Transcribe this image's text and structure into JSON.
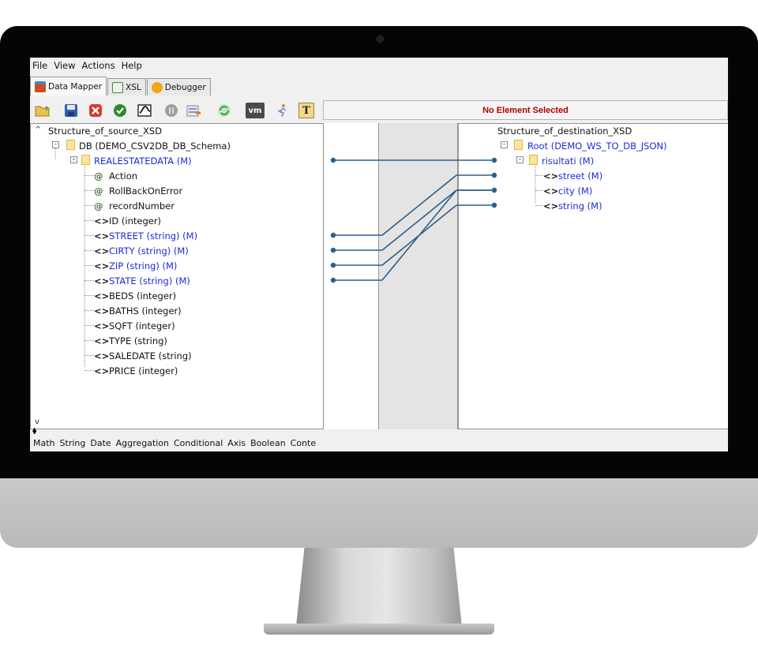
{
  "menu": [
    "File",
    "View",
    "Actions",
    "Help"
  ],
  "tabs": [
    {
      "label": "Data Mapper",
      "icon": "gift-icon",
      "active": true
    },
    {
      "label": "XSL",
      "icon": "xsl-file-icon",
      "active": false
    },
    {
      "label": "Debugger",
      "icon": "debugger-gear-icon",
      "active": false
    }
  ],
  "toolbar": {
    "buttons": [
      {
        "icon": "open-folder-icon"
      },
      {
        "icon": "save-disk-icon"
      },
      {
        "icon": "delete-x-icon"
      },
      {
        "icon": "validate-check-icon"
      },
      {
        "icon": "map-function-icon"
      },
      {
        "icon": "stop-circle-icon"
      },
      {
        "icon": "export-icon"
      },
      {
        "icon": "refresh-icon"
      },
      {
        "icon": "vm-icon",
        "label": "vm"
      },
      {
        "icon": "run-figure-icon"
      },
      {
        "icon": "text-icon",
        "label": "T"
      }
    ],
    "status_text": "No Element Selected",
    "status_color": "#b00000"
  },
  "source": {
    "title": "Structure_of_source_XSD",
    "db": "DB (DEMO_CSV2DB_DB_Schema)",
    "record": "REALESTATEDATA  (M)",
    "fields": [
      {
        "prefix": "@",
        "label": "Action",
        "mapped": false
      },
      {
        "prefix": "@",
        "label": "RollBackOnError",
        "mapped": false
      },
      {
        "prefix": "@",
        "label": "recordNumber",
        "mapped": false
      },
      {
        "prefix": "<>",
        "label": "ID  (integer)",
        "mapped": false
      },
      {
        "prefix": "<>",
        "label": "STREET  (string)  (M)",
        "mapped": true
      },
      {
        "prefix": "<>",
        "label": "CIRTY  (string)  (M)",
        "mapped": true
      },
      {
        "prefix": "<>",
        "label": "ZIP  (string)  (M)",
        "mapped": true
      },
      {
        "prefix": "<>",
        "label": "STATE  (string)  (M)",
        "mapped": true
      },
      {
        "prefix": "<>",
        "label": "BEDS  (integer)",
        "mapped": false
      },
      {
        "prefix": "<>",
        "label": "BATHS  (integer)",
        "mapped": false
      },
      {
        "prefix": "<>",
        "label": "SQFT  (integer)",
        "mapped": false
      },
      {
        "prefix": "<>",
        "label": "TYPE  (string)",
        "mapped": false
      },
      {
        "prefix": "<>",
        "label": "SALEDATE  (string)",
        "mapped": false
      },
      {
        "prefix": "<>",
        "label": "PRICE  (integer)",
        "mapped": false
      }
    ]
  },
  "destination": {
    "title": "Structure_of_destination_XSD",
    "root": "Root (DEMO_WS_TO_DB_JSON)",
    "group": "risultati  (M)",
    "fields": [
      {
        "prefix": "<>",
        "label": "street  (M)"
      },
      {
        "prefix": "<>",
        "label": "city  (M)"
      },
      {
        "prefix": "<>",
        "label": "string  (M)"
      }
    ]
  },
  "bottom_tabs": [
    "Math",
    "String",
    "Date",
    "Aggregation",
    "Conditional",
    "Axis",
    "Boolean",
    "Conte"
  ],
  "colors": {
    "mapped_text": "#1c2bd6",
    "connector": "#2a5e8c",
    "status": "#b00000"
  }
}
